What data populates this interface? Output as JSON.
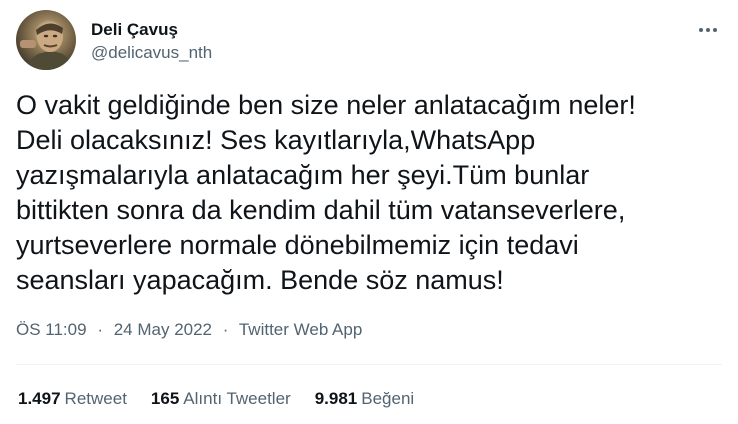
{
  "author": {
    "name": "Deli Çavuş",
    "handle": "@delicavus_nth"
  },
  "tweet": {
    "lines": [
      "O vakit geldiğinde ben size neler anlatacağım neler!",
      "Deli olacaksınız! Ses kayıtlarıyla,WhatsApp",
      "yazışmalarıyla anlatacağım her şeyi.Tüm bunlar",
      "bittikten sonra da kendim dahil tüm vatanseverlere,",
      "yurtseverlere normale dönebilmemiz için tedavi",
      "seansları yapacağım. Bende söz namus!"
    ]
  },
  "meta": {
    "time": "ÖS 11:09",
    "separator": "·",
    "date": "24 May 2022",
    "source": "Twitter Web App"
  },
  "stats": {
    "retweets": {
      "count": "1.497",
      "label": "Retweet"
    },
    "quotes": {
      "count": "165",
      "label": "Alıntı Tweetler"
    },
    "likes": {
      "count": "9.981",
      "label": "Beğeni"
    }
  },
  "icons": {
    "more": "more-options-icon"
  },
  "colors": {
    "text": "#0f1419",
    "secondary": "#536471",
    "divider": "#eff3f4"
  }
}
